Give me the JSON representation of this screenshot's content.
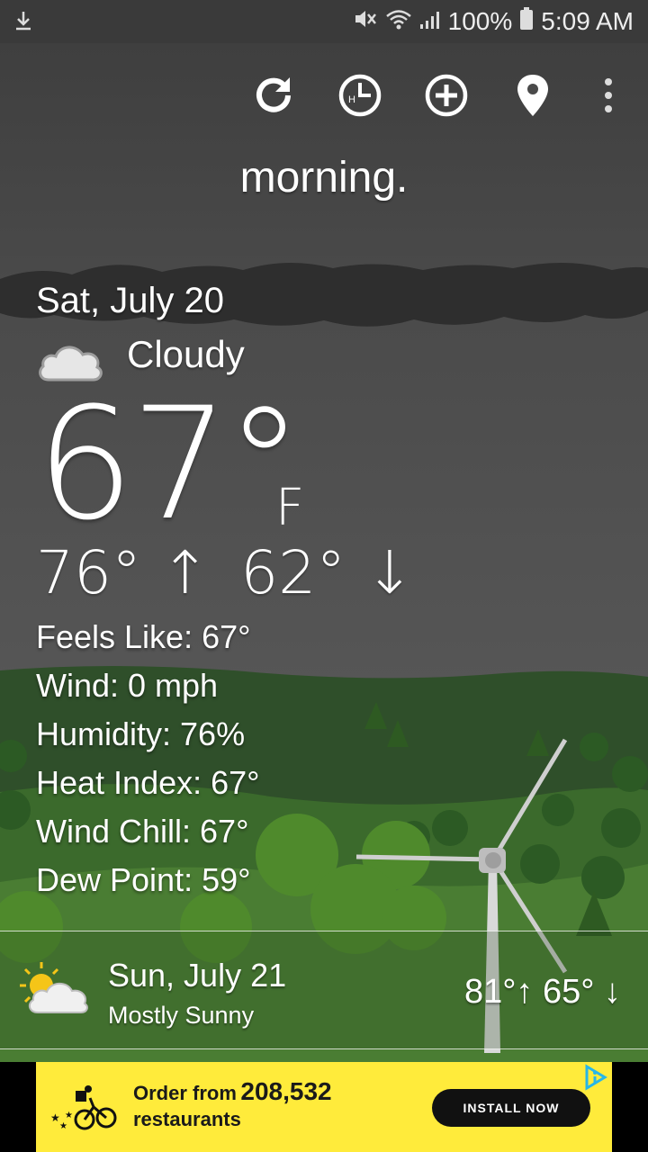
{
  "status_bar": {
    "battery": "100%",
    "time": "5:09 AM"
  },
  "toolbar": {
    "icons": [
      "refresh-icon",
      "hourly-clock-icon",
      "add-location-icon",
      "location-pin-icon",
      "more-vert-icon"
    ]
  },
  "greeting": "morning.",
  "current": {
    "date": "Sat, July 20",
    "condition": "Cloudy",
    "condition_icon": "cloud-icon",
    "temp": "67°",
    "unit": "F",
    "high": "76°",
    "low": "62°",
    "details": [
      "Feels Like: 67°",
      "Wind: 0 mph",
      "Humidity: 76%",
      "Heat Index: 67°",
      "Wind Chill: 67°",
      "Dew Point: 59°"
    ]
  },
  "forecast": {
    "date": "Sun, July 21",
    "condition": "Mostly Sunny",
    "condition_icon": "partly-sunny-icon",
    "high": "81°",
    "low": "65°"
  },
  "ad": {
    "line1": "Order from",
    "number": "208,532",
    "line2": "restaurants",
    "button": "INSTALL NOW"
  },
  "colors": {
    "ad_background": "#ffeb3b",
    "status_bar": "#3a3a3a",
    "sky": "#555555",
    "hills": "#3f6b2a"
  }
}
